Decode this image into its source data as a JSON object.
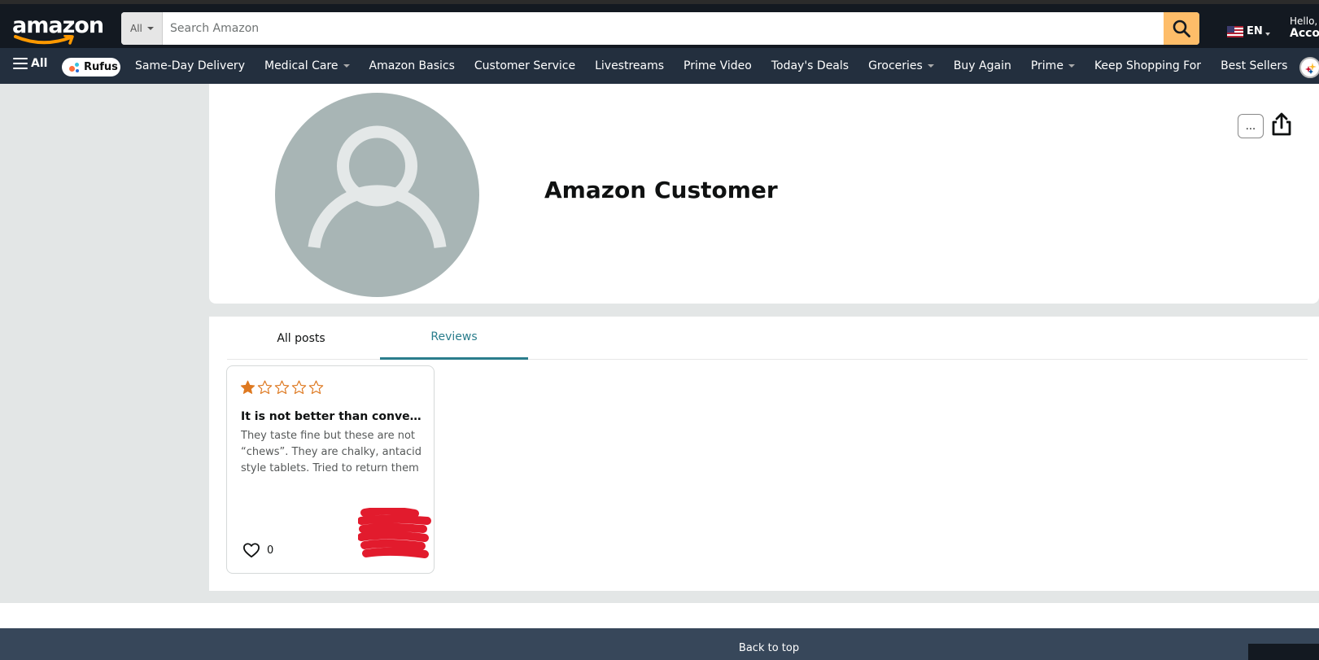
{
  "header": {
    "logo_text": "amazon",
    "search": {
      "category": "All",
      "placeholder": "Search Amazon",
      "value": ""
    },
    "language": "EN",
    "account_greeting": "Hello,",
    "account_label": "Accou"
  },
  "nav": {
    "all_label": "All",
    "rufus_label": "Rufus",
    "items": [
      {
        "label": "Same-Day Delivery",
        "dropdown": false
      },
      {
        "label": "Medical Care",
        "dropdown": true
      },
      {
        "label": "Amazon Basics",
        "dropdown": false
      },
      {
        "label": "Customer Service",
        "dropdown": false
      },
      {
        "label": "Livestreams",
        "dropdown": false
      },
      {
        "label": "Prime Video",
        "dropdown": false
      },
      {
        "label": "Today's Deals",
        "dropdown": false
      },
      {
        "label": "Groceries",
        "dropdown": true
      },
      {
        "label": "Buy Again",
        "dropdown": false
      },
      {
        "label": "Prime",
        "dropdown": true
      },
      {
        "label": "Keep Shopping For",
        "dropdown": false
      },
      {
        "label": "Best Sellers",
        "dropdown": false
      }
    ]
  },
  "profile": {
    "name": "Amazon Customer",
    "more_label": "..."
  },
  "tabs": [
    {
      "label": "All posts",
      "active": false
    },
    {
      "label": "Reviews",
      "active": true
    }
  ],
  "review": {
    "rating": 1,
    "max_rating": 5,
    "title": "It is not better than conventional antacid",
    "body": "They taste fine but these are not “chews”. They are chalky, antacid style tablets. Tried to return them",
    "likes": "0"
  },
  "footer": {
    "back_to_top": "Back to top"
  },
  "colors": {
    "header_bg": "#131921",
    "nav_bg": "#232f3e",
    "search_button": "#febd69",
    "tab_active": "#2a7d8c",
    "star": "#de7921",
    "footer_bg": "#37475a"
  }
}
